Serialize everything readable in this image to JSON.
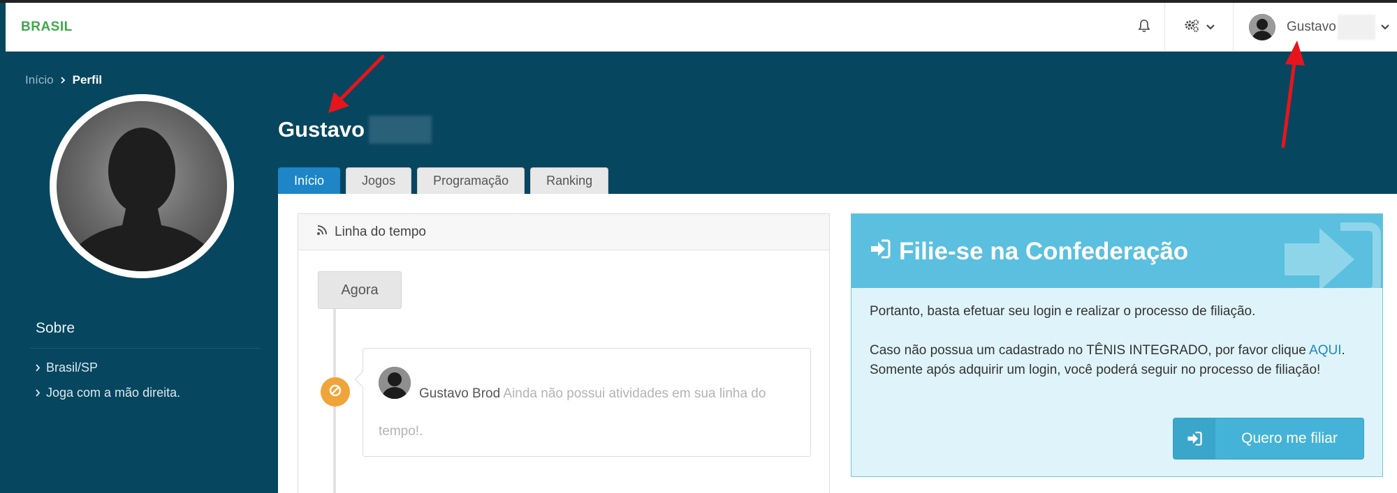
{
  "topbar": {
    "brand": "BRASIL",
    "user_name": "Gustavo"
  },
  "breadcrumb": {
    "home": "Início",
    "current": "Perfil"
  },
  "profile": {
    "name": "Gustavo"
  },
  "tabs": [
    {
      "label": "Início",
      "active": true
    },
    {
      "label": "Jogos",
      "active": false
    },
    {
      "label": "Programação",
      "active": false
    },
    {
      "label": "Ranking",
      "active": false
    }
  ],
  "sobre": {
    "title": "Sobre",
    "items": [
      "Brasil/SP",
      "Joga com a mão direita."
    ]
  },
  "timeline": {
    "title": "Linha do tempo",
    "agora_label": "Agora",
    "entry_author": "Gustavo Brod",
    "entry_text": "Ainda não possui atividades em sua linha do tempo!."
  },
  "filiacao": {
    "title": "Filie-se na Confederação",
    "paragraph1": "Portanto, basta efetuar seu login e realizar o processo de filiação.",
    "paragraph2_before": "Caso não possua um cadastrado no TÊNIS INTEGRADO, por favor clique ",
    "paragraph2_link": "AQUI",
    "paragraph2_after": ". Somente após adquirir um login, você poderá seguir no processo de filiação!",
    "button_label": "Quero me filiar"
  },
  "colors": {
    "brand_green": "#3ea84a",
    "header_bg": "#07465f",
    "tab_active": "#1e85c6",
    "filie_header": "#5bbfdf",
    "timeline_dot": "#f0a53a",
    "annotation_red": "#e8141b"
  },
  "icons": {
    "bell": "bell-icon",
    "gears": "gears-icon",
    "rss": "rss-icon",
    "sign_in": "sign-in-icon",
    "ban": "ban-icon"
  }
}
